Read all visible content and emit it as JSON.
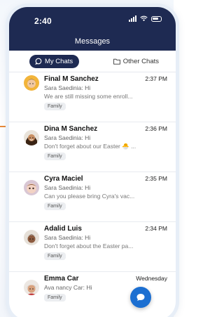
{
  "status_bar": {
    "time": "2:40"
  },
  "header": {
    "title": "Messages"
  },
  "tabs": [
    {
      "label": "My Chats",
      "icon": "chat-bubble-icon",
      "active": true
    },
    {
      "label": "Other Chats",
      "icon": "folder-icon",
      "active": false
    }
  ],
  "chats": [
    {
      "name": "Final M Sanchez",
      "time": "2:37 PM",
      "sender": "Sara  Saedinia: Hi",
      "preview": "We are still missing some enroll...",
      "tag": "Family"
    },
    {
      "name": "Dina M Sanchez",
      "time": "2:36 PM",
      "sender": "Sara  Saedinia: Hi",
      "preview": "Don't forget about our Easter 🐣 ...",
      "tag": "Family"
    },
    {
      "name": "Cyra Maciel",
      "time": "2:35 PM",
      "sender": "Sara  Saedinia: Hi",
      "preview": "Can you please bring Cyra's vac...",
      "tag": "Family"
    },
    {
      "name": "Adalid Luis",
      "time": "2:34 PM",
      "sender": "Sara  Saedinia: Hi",
      "preview": "Don't forget about the Easter pa...",
      "tag": "Family"
    },
    {
      "name": "Emma Car",
      "time": "Wednesday",
      "sender": "Ava nancy Car: Hi",
      "preview": "",
      "tag": "Family"
    }
  ],
  "colors": {
    "header_bg": "#1e2a52",
    "accent": "#1c6fd1",
    "connector": "#e88a3a"
  }
}
